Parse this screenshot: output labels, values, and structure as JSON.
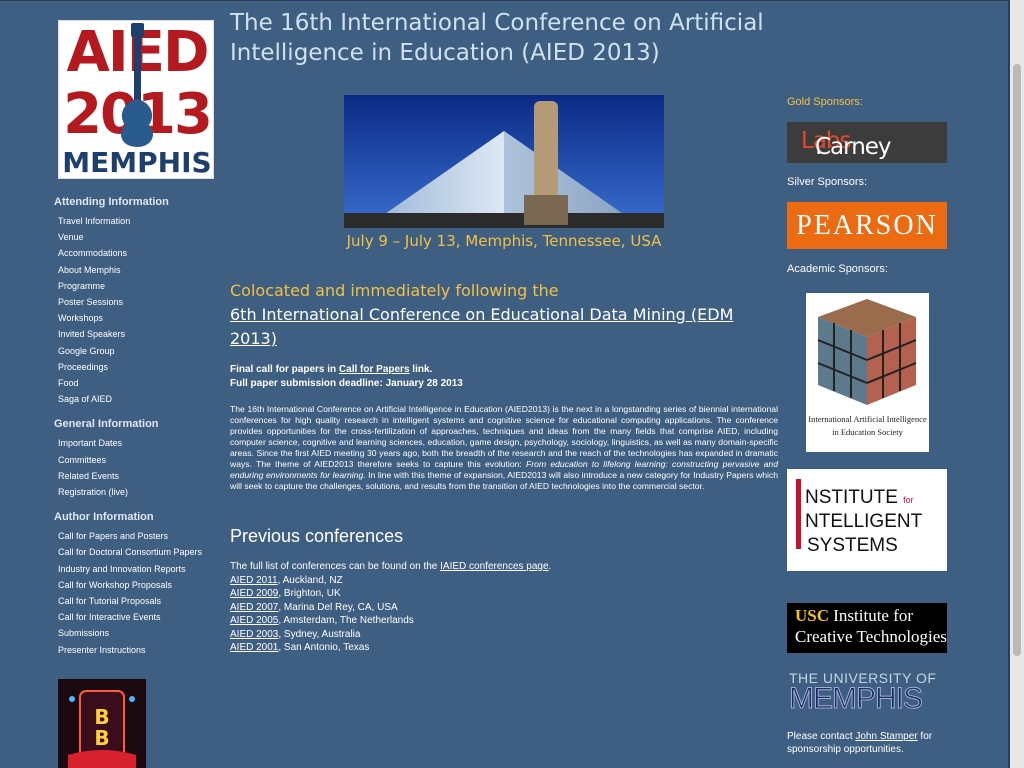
{
  "logo": {
    "line1": "AIED",
    "line2": "2013",
    "line3": "MEMPHIS"
  },
  "nav": {
    "sections": [
      {
        "heading": "Attending Information",
        "items": [
          "Travel Information",
          "Venue",
          "Accommodations",
          "About Memphis",
          "Programme",
          "Poster Sessions",
          "Workshops",
          "Invited Speakers",
          "Google Group",
          "Proceedings",
          "Food",
          "Saga of AIED"
        ]
      },
      {
        "heading": "General Information",
        "items": [
          "Important Dates",
          "Committees",
          "Related Events",
          "Registration (live)"
        ]
      },
      {
        "heading": "Author Information",
        "items": [
          "Call for Papers and Posters",
          "Call for Doctoral Consortium Papers",
          "Industry and Innovation Reports",
          "Call for Workshop Proposals",
          "Call for Tutorial Proposals",
          "Call for Interactive Events",
          "Submissions",
          "Presenter Instructions"
        ]
      }
    ]
  },
  "main": {
    "title": "The 16th International Conference on Artificial Intelligence in Education (AIED 2013)",
    "dates": "July 9 – July 13, Memphis, Tennessee, USA",
    "colocated": "Colocated and immediately following the",
    "edm_link": "6th International Conference on Educational Data Mining (EDM 2013)",
    "cfp_prefix": "Final call for papers in ",
    "cfp_link": "Call for Papers",
    "cfp_suffix": " link.",
    "deadline": "Full paper submission deadline: January 28 2013",
    "desc_part1": "The 16th International Conference on Artificial Intelligence in Education (AIED2013) is the next in a longstanding series of biennial international conferences for high quality research in intelligent systems and cognitive science for educational computing applications. The conference provides opportunities for the cross-fertilization of approaches, techniques and ideas from the many fields that comprise AIED, including computer science, cognitive and learning sciences, education, game design, psychology, sociology, linguistics, as well as many domain-specific areas. Since the first AIED meeting 30 years ago, both the breadth of the research and the reach of the technologies has expanded in dramatic ways. The theme of AIED2013 therefore seeks to capture this evolution: ",
    "desc_italic": "From education to lifelong learning: constructing pervasive and enduring environments for learning.",
    "desc_part2": " In line with this theme of expansion, AIED2013 will also introduce a new category for Industry Papers which will seek to capture the challenges, solutions, and results from the transition of AIED technologies into the commercial sector.",
    "prev_heading": "Previous conferences",
    "prev_intro": "The full list of conferences can be found on the ",
    "prev_intro_link": "IAIED conferences page",
    "prev_intro_end": ".",
    "previous": [
      {
        "link": "AIED 2011",
        "place": ", Auckland, NZ"
      },
      {
        "link": "AIED 2009",
        "place": ", Brighton, UK"
      },
      {
        "link": "AIED 2007",
        "place": ", Marina Del Rey, CA, USA"
      },
      {
        "link": "AIED 2005",
        "place": ", Amsterdam, The Netherlands"
      },
      {
        "link": "AIED 2003",
        "place": ", Sydney, Australia"
      },
      {
        "link": "AIED 2001",
        "place": ", San Antonio, Texas"
      }
    ]
  },
  "sponsors": {
    "gold_label": "Gold Sponsors:",
    "carney_a": "Carney",
    "carney_b": "Labs",
    "carney_c": ".",
    "silver_label": "Silver Sponsors:",
    "pearson": "PEARSON",
    "academic_label": "Academic Sponsors:",
    "iaied_text": "International Artificial Intelligence in Education Society",
    "iis_1": "NSTITUTE",
    "iis_for": "for",
    "iis_2": "NTELLIGENT",
    "iis_3": "SYSTEMS",
    "ict_a": "USC",
    "ict_b": " Institute for",
    "ict_c": "Creative Technologies",
    "memphis_a": "THE UNIVERSITY OF",
    "memphis_b": "MEMPHIS",
    "contact_prefix": "Please contact ",
    "contact_link": "John Stamper",
    "contact_suffix": " for sponsorship opportunities."
  },
  "colors": {
    "background": "#3e5f82",
    "title": "#cfe0ee",
    "accent_gold": "#f2c144"
  }
}
